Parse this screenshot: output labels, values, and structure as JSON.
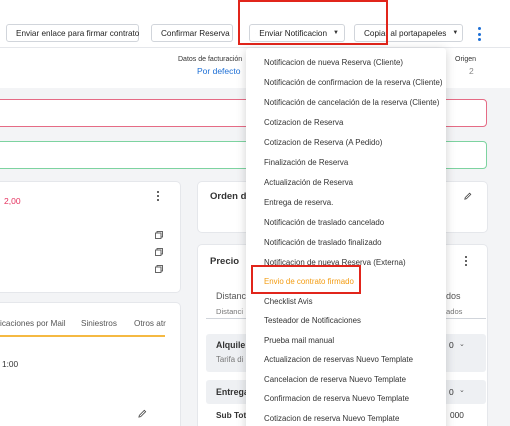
{
  "toolbar": {
    "send_link_label": "Enviar enlace para firmar contrato",
    "confirm_label": "Confirmar Reserva",
    "notify_label": "Enviar Notificacion",
    "copy_label": "Copiar al portapapeles"
  },
  "info": {
    "billing_label": "Datos de facturación",
    "billing_value": "Por defecto",
    "origin_label": "Origen",
    "origin_value": "2"
  },
  "left_card": {
    "amount": "2,00",
    "time": "1:00"
  },
  "tabs": [
    "icaciones por Mail",
    "Siniestros",
    "Otros atr"
  ],
  "right_cards": {
    "orden_title": "Orden de",
    "precio_title": "Precio",
    "distancia_label": "Distanc",
    "distancia_sub": "Distanci",
    "dos_label": "dos",
    "dos_sub": "ados",
    "alquiler_label": "Alquiler",
    "tarifa_label": "Tarifa di",
    "entrega_label": "Entrega",
    "subtotal_label": "Sub Tota",
    "val_0a": "0",
    "val_0b": "0",
    "val_000": "000"
  },
  "menu": {
    "items": [
      "Notificacion de nueva Reserva (Cliente)",
      "Notificación de confirmacion de la reserva (Cliente)",
      "Notificación de cancelación de la reserva (Cliente)",
      "Cotizacion de Reserva",
      "Cotizacion de Reserva (A Pedido)",
      "Finalización de Reserva",
      "Actualización de Reserva",
      "Entrega de reserva.",
      "Notificación de traslado cancelado",
      "Notificación de traslado finalizado",
      "Notificacion de nueva Reserva (Externa)",
      "Envio de contrato firmado",
      "Checklist Avis",
      "Testeador de Notificaciones",
      "Prueba mail manual",
      "Actualizacion de reservas Nuevo Template",
      "Cancelacion de reserva Nuevo Template",
      "Confirmacion de reserva Nuevo Template",
      "Cotizacion de reserva Nuevo Template"
    ],
    "active_index": 11
  },
  "colors": {
    "accent": "#1d6fd6",
    "highlight": "#e1251b",
    "active_item": "#f39c12",
    "pink": "#e5305d"
  }
}
